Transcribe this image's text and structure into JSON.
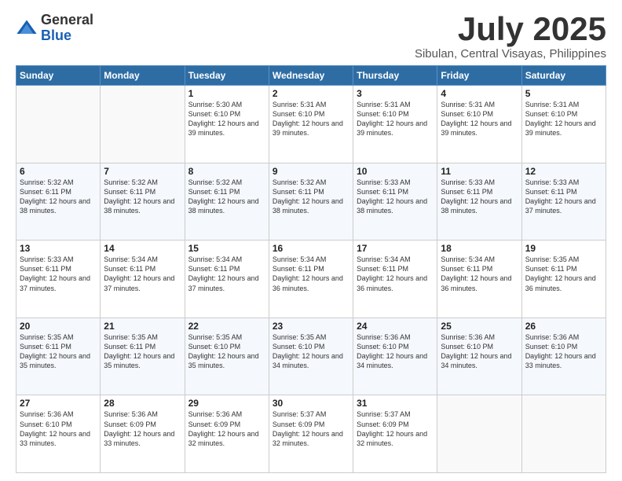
{
  "logo": {
    "general": "General",
    "blue": "Blue"
  },
  "title": "July 2025",
  "subtitle": "Sibulan, Central Visayas, Philippines",
  "weekdays": [
    "Sunday",
    "Monday",
    "Tuesday",
    "Wednesday",
    "Thursday",
    "Friday",
    "Saturday"
  ],
  "weeks": [
    [
      {
        "day": "",
        "info": ""
      },
      {
        "day": "",
        "info": ""
      },
      {
        "day": "1",
        "info": "Sunrise: 5:30 AM\nSunset: 6:10 PM\nDaylight: 12 hours and 39 minutes."
      },
      {
        "day": "2",
        "info": "Sunrise: 5:31 AM\nSunset: 6:10 PM\nDaylight: 12 hours and 39 minutes."
      },
      {
        "day": "3",
        "info": "Sunrise: 5:31 AM\nSunset: 6:10 PM\nDaylight: 12 hours and 39 minutes."
      },
      {
        "day": "4",
        "info": "Sunrise: 5:31 AM\nSunset: 6:10 PM\nDaylight: 12 hours and 39 minutes."
      },
      {
        "day": "5",
        "info": "Sunrise: 5:31 AM\nSunset: 6:10 PM\nDaylight: 12 hours and 39 minutes."
      }
    ],
    [
      {
        "day": "6",
        "info": "Sunrise: 5:32 AM\nSunset: 6:11 PM\nDaylight: 12 hours and 38 minutes."
      },
      {
        "day": "7",
        "info": "Sunrise: 5:32 AM\nSunset: 6:11 PM\nDaylight: 12 hours and 38 minutes."
      },
      {
        "day": "8",
        "info": "Sunrise: 5:32 AM\nSunset: 6:11 PM\nDaylight: 12 hours and 38 minutes."
      },
      {
        "day": "9",
        "info": "Sunrise: 5:32 AM\nSunset: 6:11 PM\nDaylight: 12 hours and 38 minutes."
      },
      {
        "day": "10",
        "info": "Sunrise: 5:33 AM\nSunset: 6:11 PM\nDaylight: 12 hours and 38 minutes."
      },
      {
        "day": "11",
        "info": "Sunrise: 5:33 AM\nSunset: 6:11 PM\nDaylight: 12 hours and 38 minutes."
      },
      {
        "day": "12",
        "info": "Sunrise: 5:33 AM\nSunset: 6:11 PM\nDaylight: 12 hours and 37 minutes."
      }
    ],
    [
      {
        "day": "13",
        "info": "Sunrise: 5:33 AM\nSunset: 6:11 PM\nDaylight: 12 hours and 37 minutes."
      },
      {
        "day": "14",
        "info": "Sunrise: 5:34 AM\nSunset: 6:11 PM\nDaylight: 12 hours and 37 minutes."
      },
      {
        "day": "15",
        "info": "Sunrise: 5:34 AM\nSunset: 6:11 PM\nDaylight: 12 hours and 37 minutes."
      },
      {
        "day": "16",
        "info": "Sunrise: 5:34 AM\nSunset: 6:11 PM\nDaylight: 12 hours and 36 minutes."
      },
      {
        "day": "17",
        "info": "Sunrise: 5:34 AM\nSunset: 6:11 PM\nDaylight: 12 hours and 36 minutes."
      },
      {
        "day": "18",
        "info": "Sunrise: 5:34 AM\nSunset: 6:11 PM\nDaylight: 12 hours and 36 minutes."
      },
      {
        "day": "19",
        "info": "Sunrise: 5:35 AM\nSunset: 6:11 PM\nDaylight: 12 hours and 36 minutes."
      }
    ],
    [
      {
        "day": "20",
        "info": "Sunrise: 5:35 AM\nSunset: 6:11 PM\nDaylight: 12 hours and 35 minutes."
      },
      {
        "day": "21",
        "info": "Sunrise: 5:35 AM\nSunset: 6:11 PM\nDaylight: 12 hours and 35 minutes."
      },
      {
        "day": "22",
        "info": "Sunrise: 5:35 AM\nSunset: 6:10 PM\nDaylight: 12 hours and 35 minutes."
      },
      {
        "day": "23",
        "info": "Sunrise: 5:35 AM\nSunset: 6:10 PM\nDaylight: 12 hours and 34 minutes."
      },
      {
        "day": "24",
        "info": "Sunrise: 5:36 AM\nSunset: 6:10 PM\nDaylight: 12 hours and 34 minutes."
      },
      {
        "day": "25",
        "info": "Sunrise: 5:36 AM\nSunset: 6:10 PM\nDaylight: 12 hours and 34 minutes."
      },
      {
        "day": "26",
        "info": "Sunrise: 5:36 AM\nSunset: 6:10 PM\nDaylight: 12 hours and 33 minutes."
      }
    ],
    [
      {
        "day": "27",
        "info": "Sunrise: 5:36 AM\nSunset: 6:10 PM\nDaylight: 12 hours and 33 minutes."
      },
      {
        "day": "28",
        "info": "Sunrise: 5:36 AM\nSunset: 6:09 PM\nDaylight: 12 hours and 33 minutes."
      },
      {
        "day": "29",
        "info": "Sunrise: 5:36 AM\nSunset: 6:09 PM\nDaylight: 12 hours and 32 minutes."
      },
      {
        "day": "30",
        "info": "Sunrise: 5:37 AM\nSunset: 6:09 PM\nDaylight: 12 hours and 32 minutes."
      },
      {
        "day": "31",
        "info": "Sunrise: 5:37 AM\nSunset: 6:09 PM\nDaylight: 12 hours and 32 minutes."
      },
      {
        "day": "",
        "info": ""
      },
      {
        "day": "",
        "info": ""
      }
    ]
  ]
}
